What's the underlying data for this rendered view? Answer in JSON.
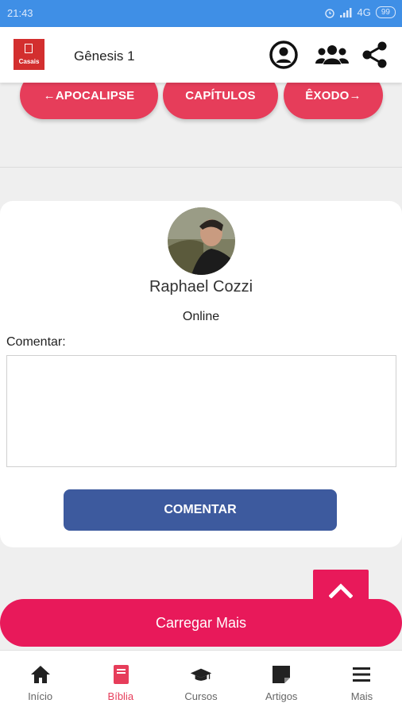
{
  "status_bar": {
    "time": "21:43",
    "network": "4G",
    "battery": "99"
  },
  "app_bar": {
    "logo_text": "Casais",
    "title": "Gênesis 1"
  },
  "chapter_nav": {
    "prev": "←APOCALIPSE",
    "chapters": "CAPÍTULOS",
    "next": "ÊXODO→"
  },
  "comment_card": {
    "user_name": "Raphael Cozzi",
    "user_status": "Online",
    "comment_label": "Comentar:",
    "comment_value": "",
    "submit_label": "COMENTAR"
  },
  "load_more": "Carregar Mais",
  "bottom_nav": [
    {
      "label": "Início",
      "icon": "home-icon"
    },
    {
      "label": "Bíblia",
      "icon": "book-icon",
      "active": true
    },
    {
      "label": "Cursos",
      "icon": "graduation-cap-icon"
    },
    {
      "label": "Artigos",
      "icon": "note-icon"
    },
    {
      "label": "Mais",
      "icon": "menu-icon"
    }
  ],
  "colors": {
    "accent": "#e63d5a",
    "pink": "#e8195a",
    "primary_blue": "#3d5a9e",
    "statusbar": "#3f8fe6"
  }
}
